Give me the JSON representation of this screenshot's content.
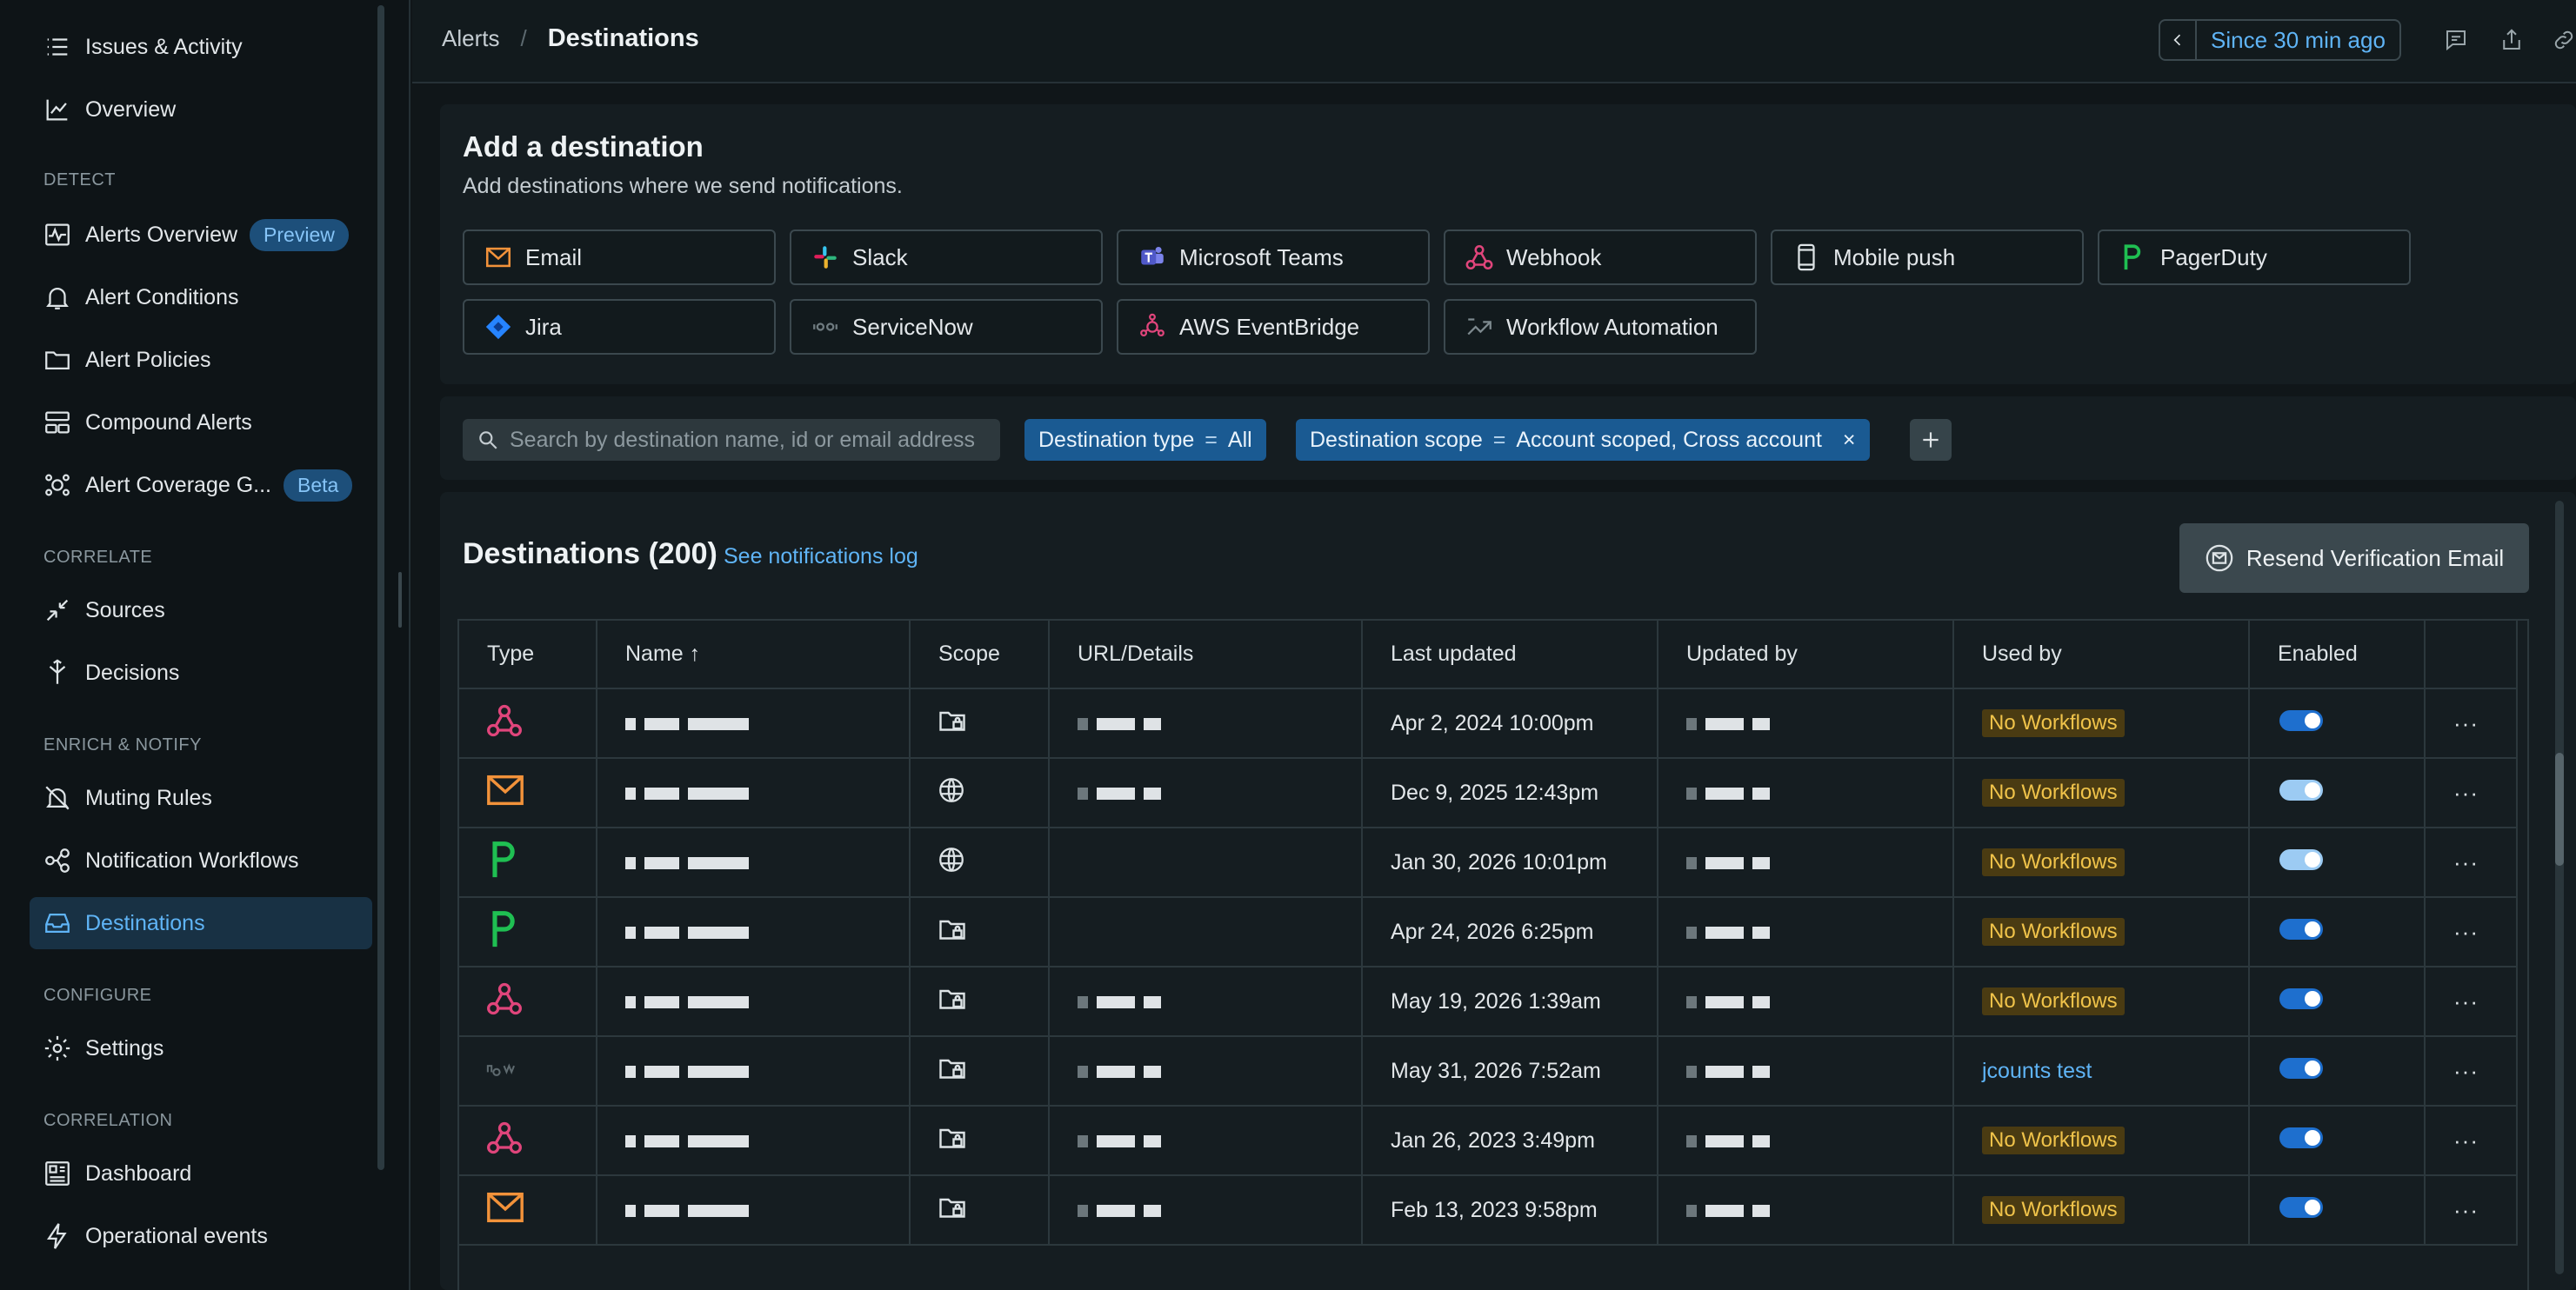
{
  "sidebar": {
    "items_top": [
      {
        "label": "Issues & Activity",
        "icon": "list-icon"
      },
      {
        "label": "Overview",
        "icon": "chart-line-icon"
      }
    ],
    "sections": {
      "detect": "DETECT",
      "correlate": "CORRELATE",
      "enrich": "ENRICH & NOTIFY",
      "configure": "CONFIGURE",
      "correlation": "CORRELATION"
    },
    "detect_items": [
      {
        "label": "Alerts Overview",
        "pill": "Preview"
      },
      {
        "label": "Alert Conditions"
      },
      {
        "label": "Alert Policies"
      },
      {
        "label": "Compound Alerts"
      },
      {
        "label": "Alert Coverage G...",
        "pill": "Beta"
      }
    ],
    "correlate_items": [
      {
        "label": "Sources"
      },
      {
        "label": "Decisions"
      }
    ],
    "enrich_items": [
      {
        "label": "Muting Rules"
      },
      {
        "label": "Notification Workflows"
      },
      {
        "label": "Destinations",
        "active": true
      }
    ],
    "configure_items": [
      {
        "label": "Settings"
      }
    ],
    "correlation_items": [
      {
        "label": "Dashboard"
      },
      {
        "label": "Operational events"
      }
    ]
  },
  "header": {
    "breadcrumb_parent": "Alerts",
    "breadcrumb_separator": "/",
    "title": "Destinations",
    "time_range": "Since 30 min ago"
  },
  "add_destination": {
    "title": "Add a destination",
    "subtitle": "Add destinations where we send notifications.",
    "buttons": [
      {
        "label": "Email",
        "icon": "email-icon"
      },
      {
        "label": "Slack",
        "icon": "slack-icon"
      },
      {
        "label": "Microsoft Teams",
        "icon": "teams-icon"
      },
      {
        "label": "Webhook",
        "icon": "webhook-icon"
      },
      {
        "label": "Mobile push",
        "icon": "mobile-icon"
      },
      {
        "label": "PagerDuty",
        "icon": "pagerduty-icon"
      },
      {
        "label": "Jira",
        "icon": "jira-icon"
      },
      {
        "label": "ServiceNow",
        "icon": "servicenow-icon"
      },
      {
        "label": "AWS EventBridge",
        "icon": "eventbridge-icon"
      },
      {
        "label": "Workflow Automation",
        "icon": "workflow-icon"
      }
    ]
  },
  "filters": {
    "search_placeholder": "Search by destination name, id or email address",
    "chip_type_key": "Destination type",
    "chip_type_op": "=",
    "chip_type_value": "All",
    "chip_scope_key": "Destination scope",
    "chip_scope_op": "=",
    "chip_scope_value": "Account scoped, Cross account",
    "chip_close": "×"
  },
  "list": {
    "title": "Destinations (200)",
    "notifications_link": "See notifications log",
    "resend_label": "Resend Verification Email",
    "columns": [
      "Type",
      "Name ↑",
      "Scope",
      "URL/Details",
      "Last updated",
      "Updated by",
      "Used by",
      "Enabled"
    ],
    "rows": [
      {
        "type": "webhook",
        "scope": "account",
        "last_updated": "Apr 2, 2024 10:00pm",
        "used_by": "No Workflows",
        "used_by_link": false,
        "enabled_light": false
      },
      {
        "type": "email",
        "scope": "global",
        "last_updated": "Dec 9, 2025 12:43pm",
        "used_by": "No Workflows",
        "used_by_link": false,
        "enabled_light": true
      },
      {
        "type": "pagerduty",
        "scope": "global",
        "last_updated": "Jan 30, 2026 10:01pm",
        "used_by": "No Workflows",
        "used_by_link": false,
        "enabled_light": true
      },
      {
        "type": "pagerduty",
        "scope": "account",
        "last_updated": "Apr 24, 2026 6:25pm",
        "used_by": "No Workflows",
        "used_by_link": false,
        "enabled_light": false
      },
      {
        "type": "webhook",
        "scope": "account",
        "last_updated": "May 19, 2026 1:39am",
        "used_by": "No Workflows",
        "used_by_link": false,
        "enabled_light": false
      },
      {
        "type": "servicenow",
        "scope": "account",
        "last_updated": "May 31, 2026 7:52am",
        "used_by": "jcounts test",
        "used_by_link": true,
        "enabled_light": false
      },
      {
        "type": "webhook",
        "scope": "account",
        "last_updated": "Jan 26, 2023 3:49pm",
        "used_by": "No Workflows",
        "used_by_link": false,
        "enabled_light": false
      },
      {
        "type": "email",
        "scope": "account",
        "last_updated": "Feb 13, 2023 9:58pm",
        "used_by": "No Workflows",
        "used_by_link": false,
        "enabled_light": false
      }
    ],
    "row_menu": "···"
  },
  "colors": {
    "accent": "#5fb4f6",
    "active_bg": "#183144",
    "badge_bg": "#4a3b12",
    "badge_fg": "#f0c34a",
    "toggle_on": "#1e6fce",
    "webhook": "#e0457b",
    "email": "#f2923a",
    "pagerduty": "#1fbf52"
  }
}
